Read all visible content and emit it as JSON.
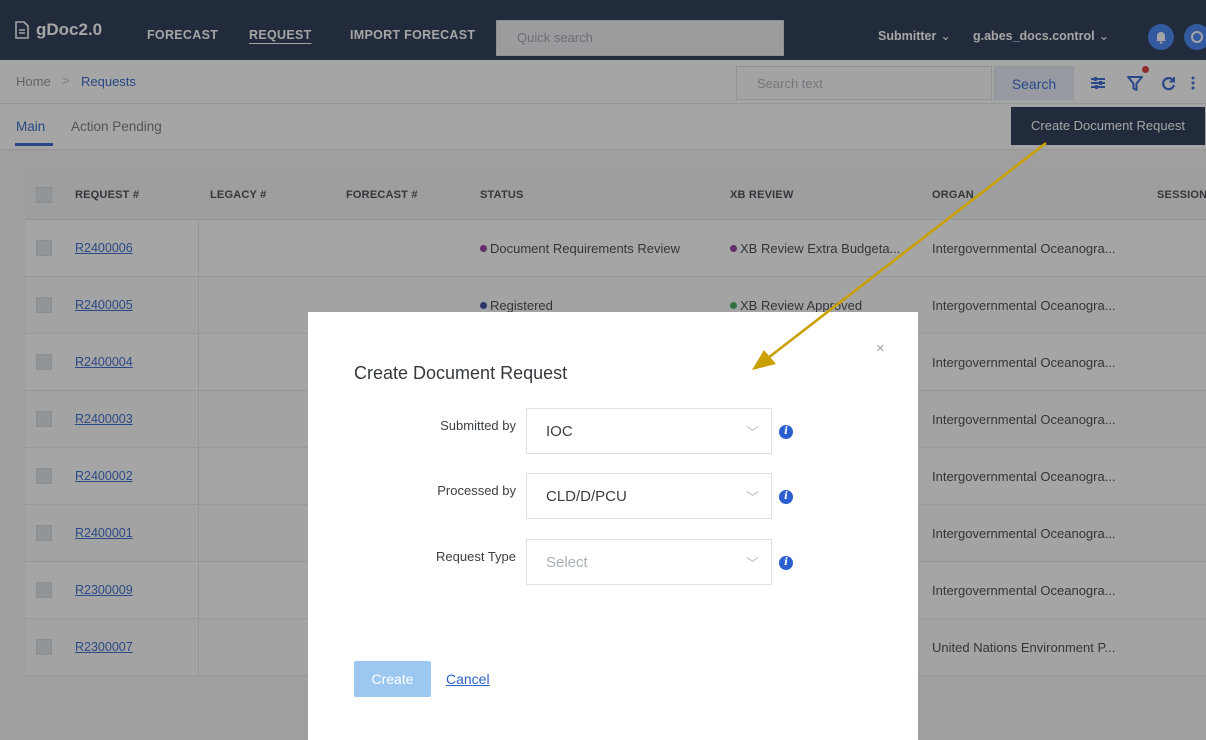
{
  "nav": {
    "brand": "gDoc2.0",
    "links": [
      "FORECAST",
      "REQUEST",
      "IMPORT FORECAST"
    ],
    "quick_search_placeholder": "Quick search",
    "role": "Submitter",
    "user": "g.abes_docs.control"
  },
  "breadcrumb": {
    "home": "Home",
    "separator": ">",
    "current": "Requests"
  },
  "search": {
    "placeholder": "Search text",
    "button": "Search"
  },
  "tabs": [
    "Main",
    "Action Pending"
  ],
  "create_request_button": "Create Document Request",
  "table": {
    "headers": [
      "REQUEST #",
      "LEGACY #",
      "FORECAST #",
      "STATUS",
      "XB REVIEW",
      "ORGAN",
      "SESSION"
    ],
    "rows": [
      {
        "request": "R2400006",
        "status": "Document Requirements Review",
        "xb": "XB Review Extra Budgeta...",
        "organ": "Intergovernmental Oceanogra..."
      },
      {
        "request": "R2400005",
        "status": "Registered",
        "xb": "XB Review Approved",
        "organ": "Intergovernmental Oceanogra..."
      },
      {
        "request": "R2400004",
        "status": "",
        "xb": "",
        "organ": "Intergovernmental Oceanogra..."
      },
      {
        "request": "R2400003",
        "status": "",
        "xb": "",
        "organ": "Intergovernmental Oceanogra..."
      },
      {
        "request": "R2400002",
        "status": "",
        "xb": "",
        "organ": "Intergovernmental Oceanogra..."
      },
      {
        "request": "R2400001",
        "status": "",
        "xb": "",
        "organ": "Intergovernmental Oceanogra..."
      },
      {
        "request": "R2300009",
        "status": "",
        "xb": "",
        "organ": "Intergovernmental Oceanogra..."
      },
      {
        "request": "R2300007",
        "status": "",
        "xb": "",
        "organ": "United Nations Environment P..."
      }
    ]
  },
  "modal": {
    "title": "Create Document Request",
    "close": "×",
    "fields": [
      {
        "label": "Submitted by",
        "value": "IOC"
      },
      {
        "label": "Processed by",
        "value": "CLD/D/PCU"
      },
      {
        "label": "Request Type",
        "value": "Select"
      }
    ],
    "create_button": "Create",
    "cancel_link": "Cancel"
  },
  "colors": {
    "nav_bg": "#1c2d4a",
    "link": "#2f63c8",
    "status_purple": "#8e2f9a",
    "status_blue": "#2d3f95",
    "status_green": "#3aa35a",
    "annotation_arrow": "#c9a000"
  },
  "icons": [
    "document-icon",
    "chevron-down-icon",
    "bell-icon",
    "help-icon",
    "filter-settings-icon",
    "filter-icon",
    "refresh-icon",
    "more-vert-icon",
    "info-icon",
    "close-icon"
  ]
}
